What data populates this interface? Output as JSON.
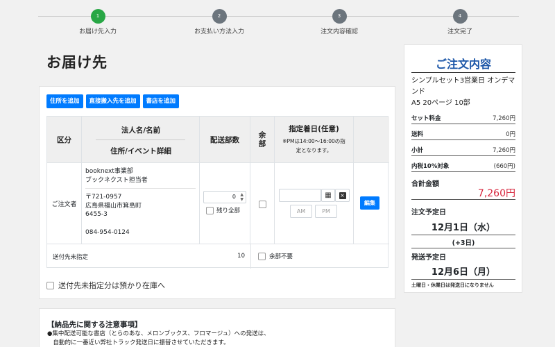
{
  "steps": [
    {
      "num": "1",
      "label": "お届け先入力",
      "active": true
    },
    {
      "num": "2",
      "label": "お支払い方法入力",
      "active": false
    },
    {
      "num": "3",
      "label": "注文内容確認",
      "active": false
    },
    {
      "num": "4",
      "label": "注文完了",
      "active": false
    }
  ],
  "page_title": "お届け先",
  "buttons": {
    "add_address": "住所を追加",
    "add_direct": "直接搬入先を追加",
    "add_store": "書店を追加"
  },
  "table": {
    "headers": {
      "category": "区分",
      "name": "法人名/名前",
      "address": "住所/イベント詳細",
      "quantity": "配送部数",
      "extra": "余部",
      "date": "指定着日(任意)",
      "date_note": "※PMは14:00〜16:00の指定となります。"
    },
    "row": {
      "category": "ご注文者",
      "company": "booknext事業部",
      "person": "ブックネクスト担当者",
      "postal": "〒721-0957",
      "address1": "広島県福山市箕島町",
      "address2": "6455-3",
      "phone": "084-954-0124",
      "quantity_value": "0",
      "remaining_all": "残り全部",
      "am": "AM",
      "pm": "PM",
      "edit": "編集"
    },
    "footer": {
      "label": "送付先未指定",
      "count": "10",
      "no_extra": "余部不要"
    }
  },
  "unassigned_note": "送付先未指定分は預かり在庫へ",
  "notice": {
    "heading": "【納品先に関する注意事項】",
    "line1": "●集中配送可能な書店（とらのあな、メロンブックス、フロマージュ）への発送は、",
    "line2": "　自動的に一番近い弊社トラック発送日に振替させていただきます。"
  },
  "summary": {
    "title": "ご注文内容",
    "product": "シンプルセット3営業日 オンデマンド",
    "spec": "A5  20ページ  10部",
    "set_price_label": "セット料金",
    "set_price": "7,260円",
    "shipping_label": "送料",
    "shipping": "0円",
    "subtotal_label": "小計",
    "subtotal": "7,260円",
    "tax_label": "内税10%対象",
    "tax": "(660円)",
    "total_label": "合計金額",
    "total": "7,260円",
    "order_date_label": "注文予定日",
    "order_date": "12月1日（水）",
    "plus_days": "(+3日)",
    "ship_date_label": "発送予定日",
    "ship_date": "12月6日（月）",
    "note": "土曜日・休業日は発送日になりません"
  },
  "colors": {
    "accent": "#007bff",
    "step_active": "#28a745",
    "step_inactive": "#6c757d",
    "total": "#d7263d",
    "title_blue": "#1b56a8"
  }
}
